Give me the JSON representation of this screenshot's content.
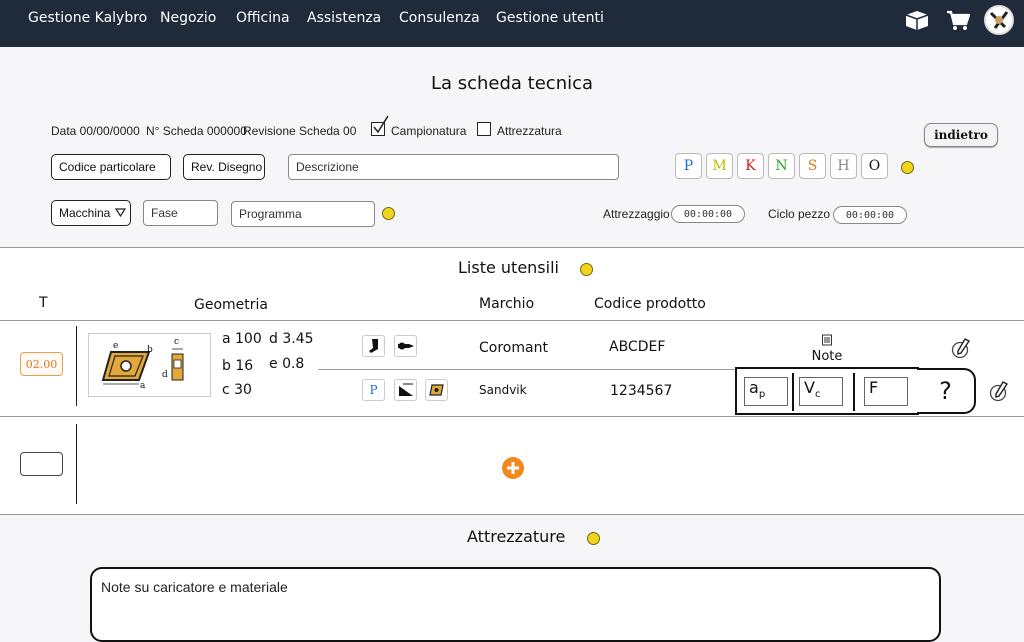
{
  "nav": {
    "items": [
      "Gestione Kalybro",
      "Negozio",
      "Officina",
      "Assistenza",
      "Consulenza",
      "Gestione utenti"
    ],
    "icons": [
      "box-icon",
      "cart-icon",
      "avatar-icon"
    ]
  },
  "sheet": {
    "title": "La scheda tecnica",
    "data": "Data 00/00/0000",
    "numero": "N° Scheda 000000",
    "revisione": "Revisione Scheda 00",
    "campionatura_label": "Campionatura",
    "campionatura_checked": true,
    "attrezzatura_label": "Attrezzatura",
    "attrezzatura_checked": false,
    "back_label": "indietro",
    "codice_particolare": "Codice particolare",
    "rev_disegno": "Rev. Disegno",
    "descrizione": "Descrizione",
    "iso_groups": [
      {
        "label": "P",
        "color": "#1a6fd6"
      },
      {
        "label": "M",
        "color": "#c8b400"
      },
      {
        "label": "K",
        "color": "#d61a1a"
      },
      {
        "label": "N",
        "color": "#2aa52a"
      },
      {
        "label": "S",
        "color": "#e07820"
      },
      {
        "label": "H",
        "color": "#888888"
      },
      {
        "label": "O",
        "color": "#111111"
      }
    ],
    "macchina": "Macchina",
    "fase": "Fase",
    "programma": "Programma",
    "attrezzaggio_label": "Attrezzaggio",
    "attrezzaggio_value": "00:00:00",
    "ciclo_label": "Ciclo pezzo",
    "ciclo_value": "00:00:00"
  },
  "tools": {
    "title": "Liste utensili",
    "headers": {
      "t": "T",
      "geometria": "Geometria",
      "marchio": "Marchio",
      "codice": "Codice prodotto"
    },
    "tool_number": "02.00",
    "geometry": {
      "a": "a 100",
      "d": "d 3.45",
      "b": "b 16",
      "e": "e 0.8",
      "c": "c 30"
    },
    "diagram_letters": {
      "a": "a",
      "b": "b",
      "c": "c",
      "d": "d",
      "e": "e"
    },
    "rows": [
      {
        "marchio": "Coromant",
        "codice": "ABCDEF"
      },
      {
        "marchio": "Sandvik",
        "codice": "1234567"
      }
    ],
    "holder_badge": "P",
    "note_label": "Note",
    "params": {
      "ap": "a",
      "ap_sub": "p",
      "vc": "V",
      "vc_sub": "c",
      "f": "F"
    },
    "help": "?"
  },
  "attrezzature": {
    "title": "Attrezzature",
    "notes_placeholder": "Note su caricatore e materiale"
  }
}
